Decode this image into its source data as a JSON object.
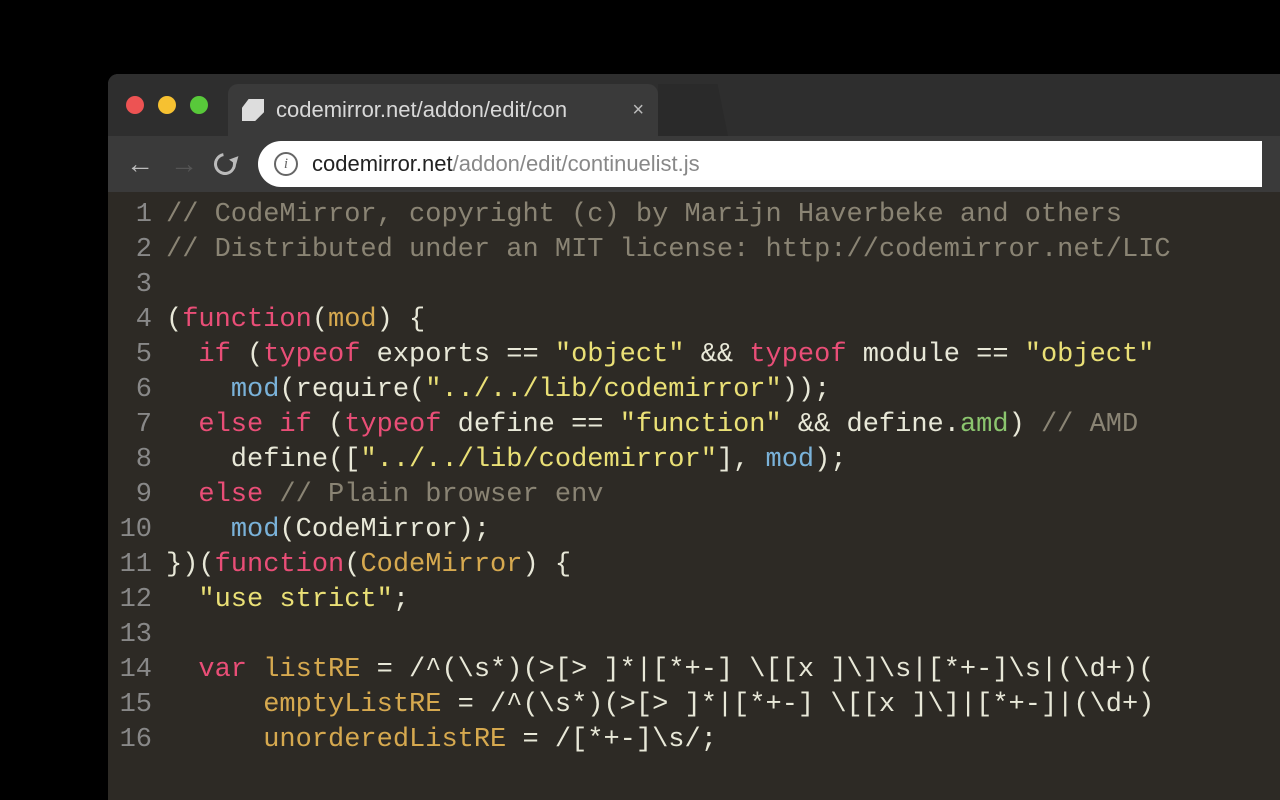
{
  "tab": {
    "title": "codemirror.net/addon/edit/con",
    "close": "×"
  },
  "url": {
    "host": "codemirror.net",
    "path": "/addon/edit/continuelist.js",
    "info": "i"
  },
  "nav": {
    "back": "←",
    "forward": "→"
  },
  "code": {
    "lines": [
      {
        "n": "1",
        "tokens": [
          {
            "c": "cm",
            "t": "// CodeMirror, copyright (c) by Marijn Haverbeke and others"
          }
        ]
      },
      {
        "n": "2",
        "tokens": [
          {
            "c": "cm",
            "t": "// Distributed under an MIT license: http://codemirror.net/LIC"
          }
        ]
      },
      {
        "n": "3",
        "tokens": [
          {
            "c": "src",
            "t": ""
          }
        ]
      },
      {
        "n": "4",
        "tokens": [
          {
            "c": "src",
            "t": "("
          },
          {
            "c": "kw",
            "t": "function"
          },
          {
            "c": "src",
            "t": "("
          },
          {
            "c": "fn",
            "t": "mod"
          },
          {
            "c": "src",
            "t": ") {"
          }
        ]
      },
      {
        "n": "5",
        "tokens": [
          {
            "c": "src",
            "t": "  "
          },
          {
            "c": "kw",
            "t": "if"
          },
          {
            "c": "src",
            "t": " ("
          },
          {
            "c": "kw",
            "t": "typeof"
          },
          {
            "c": "src",
            "t": " exports == "
          },
          {
            "c": "st",
            "t": "\"object\""
          },
          {
            "c": "src",
            "t": " && "
          },
          {
            "c": "kw",
            "t": "typeof"
          },
          {
            "c": "src",
            "t": " module == "
          },
          {
            "c": "st",
            "t": "\"object\""
          }
        ]
      },
      {
        "n": "6",
        "tokens": [
          {
            "c": "src",
            "t": "    "
          },
          {
            "c": "bi",
            "t": "mod"
          },
          {
            "c": "src",
            "t": "(require("
          },
          {
            "c": "st",
            "t": "\"../../lib/codemirror\""
          },
          {
            "c": "src",
            "t": "));"
          }
        ]
      },
      {
        "n": "7",
        "tokens": [
          {
            "c": "src",
            "t": "  "
          },
          {
            "c": "kw",
            "t": "else if"
          },
          {
            "c": "src",
            "t": " ("
          },
          {
            "c": "kw",
            "t": "typeof"
          },
          {
            "c": "src",
            "t": " define == "
          },
          {
            "c": "st",
            "t": "\"function\""
          },
          {
            "c": "src",
            "t": " && define."
          },
          {
            "c": "nm",
            "t": "amd"
          },
          {
            "c": "src",
            "t": ") "
          },
          {
            "c": "cm",
            "t": "// AMD"
          }
        ]
      },
      {
        "n": "8",
        "tokens": [
          {
            "c": "src",
            "t": "    define(["
          },
          {
            "c": "st",
            "t": "\"../../lib/codemirror\""
          },
          {
            "c": "src",
            "t": "], "
          },
          {
            "c": "bi",
            "t": "mod"
          },
          {
            "c": "src",
            "t": ");"
          }
        ]
      },
      {
        "n": "9",
        "tokens": [
          {
            "c": "src",
            "t": "  "
          },
          {
            "c": "kw",
            "t": "else"
          },
          {
            "c": "src",
            "t": " "
          },
          {
            "c": "cm",
            "t": "// Plain browser env"
          }
        ]
      },
      {
        "n": "10",
        "tokens": [
          {
            "c": "src",
            "t": "    "
          },
          {
            "c": "bi",
            "t": "mod"
          },
          {
            "c": "src",
            "t": "(CodeMirror);"
          }
        ]
      },
      {
        "n": "11",
        "tokens": [
          {
            "c": "src",
            "t": "})("
          },
          {
            "c": "kw",
            "t": "function"
          },
          {
            "c": "src",
            "t": "("
          },
          {
            "c": "fn",
            "t": "CodeMirror"
          },
          {
            "c": "src",
            "t": ") {"
          }
        ]
      },
      {
        "n": "12",
        "tokens": [
          {
            "c": "src",
            "t": "  "
          },
          {
            "c": "st",
            "t": "\"use strict\""
          },
          {
            "c": "src",
            "t": ";"
          }
        ]
      },
      {
        "n": "13",
        "tokens": [
          {
            "c": "src",
            "t": ""
          }
        ]
      },
      {
        "n": "14",
        "tokens": [
          {
            "c": "src",
            "t": "  "
          },
          {
            "c": "kw",
            "t": "var"
          },
          {
            "c": "src",
            "t": " "
          },
          {
            "c": "fn",
            "t": "listRE"
          },
          {
            "c": "src",
            "t": " = /^(\\s*)(>[> ]*|[*+-] \\[[x ]\\]\\s|[*+-]\\s|(\\d+)("
          }
        ]
      },
      {
        "n": "15",
        "tokens": [
          {
            "c": "src",
            "t": "      "
          },
          {
            "c": "fn",
            "t": "emptyListRE"
          },
          {
            "c": "src",
            "t": " = /^(\\s*)(>[> ]*|[*+-] \\[[x ]\\]|[*+-]|(\\d+)"
          }
        ]
      },
      {
        "n": "16",
        "tokens": [
          {
            "c": "src",
            "t": "      "
          },
          {
            "c": "fn",
            "t": "unorderedListRE"
          },
          {
            "c": "src",
            "t": " = /[*+-]\\s/;"
          }
        ]
      }
    ]
  }
}
